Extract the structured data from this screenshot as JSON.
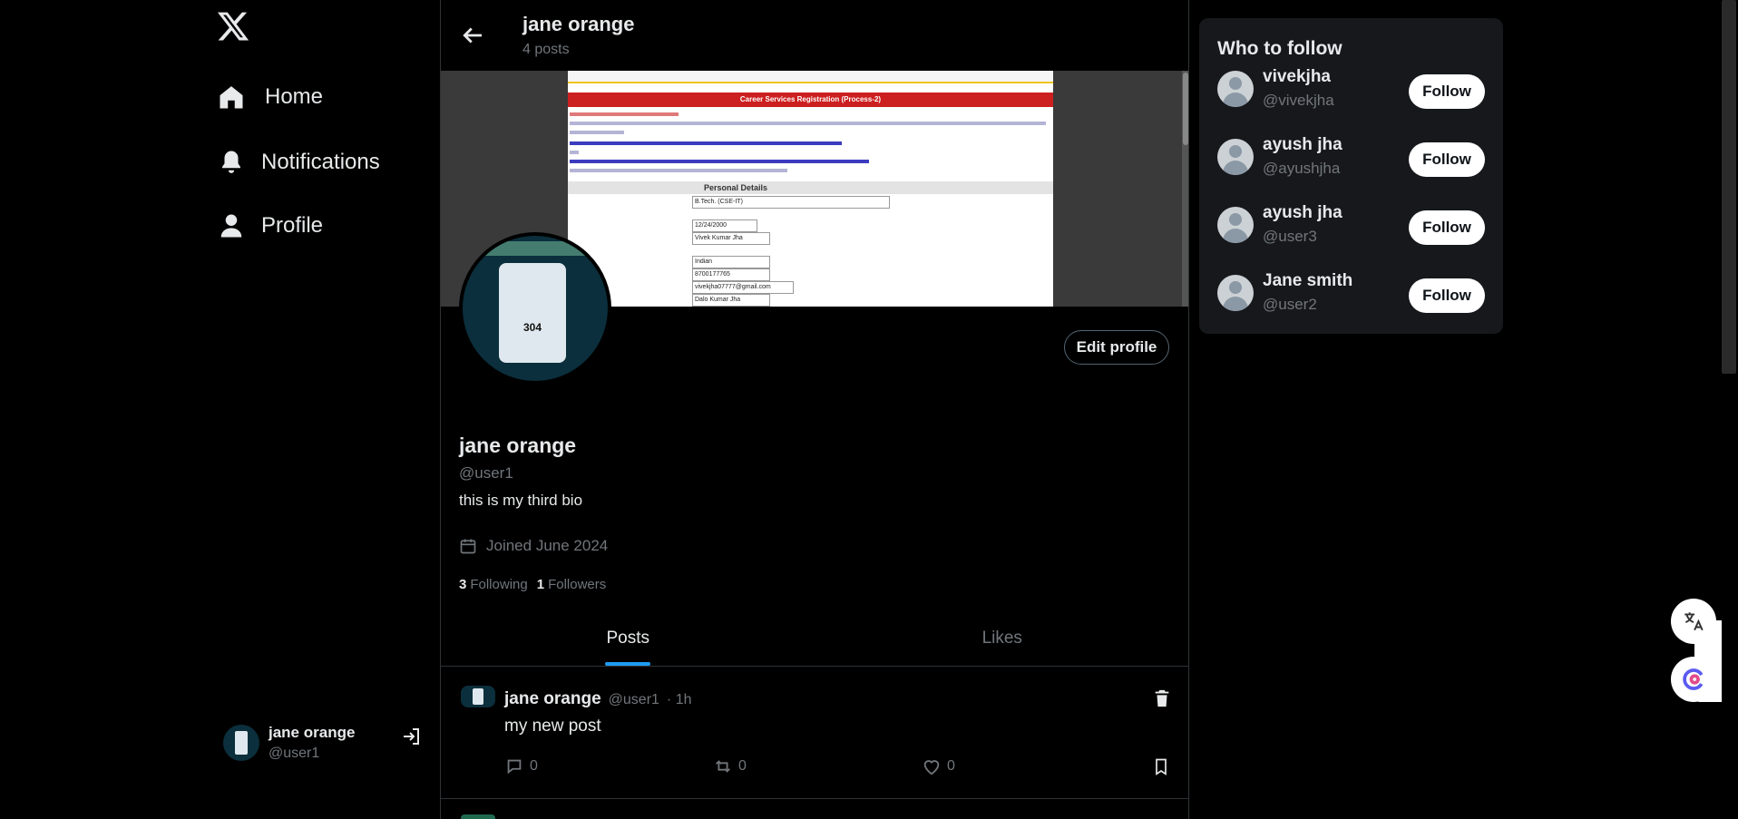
{
  "nav": {
    "items": [
      {
        "label": "Home",
        "icon": "home-icon"
      },
      {
        "label": "Notifications",
        "icon": "bell-icon"
      },
      {
        "label": "Profile",
        "icon": "person-icon"
      }
    ],
    "me": {
      "name": "jane orange",
      "handle": "@user1"
    }
  },
  "header": {
    "title": "jane orange",
    "subtitle": "4 posts"
  },
  "banner": {
    "doc_title": "Career Services Registration (Process-2)",
    "table_header": "Personal Details",
    "fields": [
      "B.Tech. (CSE-IT)",
      "12/24/2000",
      "Vivek Kumar Jha",
      "Indian",
      "8700177765",
      "vivekjha07777@gmail.com",
      "Dalo Kumar Jha"
    ],
    "phone_text": "304"
  },
  "profile": {
    "name": "jane orange",
    "handle": "@user1",
    "bio": "this is my third bio",
    "joined": "Joined June 2024",
    "following_count": "3",
    "following_label": "Following",
    "followers_count": "1",
    "followers_label": "Followers",
    "edit_label": "Edit profile"
  },
  "tabs": [
    "Posts",
    "Likes"
  ],
  "posts": [
    {
      "name": "jane orange",
      "handle": "@user1",
      "time": "· 1h",
      "text": "my new post",
      "replies": "0",
      "reposts": "0",
      "likes": "0"
    }
  ],
  "who_to_follow": {
    "title": "Who to follow",
    "follow_label": "Follow",
    "users": [
      {
        "name": "vivekjha",
        "handle": "@vivekjha"
      },
      {
        "name": "ayush jha",
        "handle": "@ayushjha"
      },
      {
        "name": "ayush jha",
        "handle": "@user3"
      },
      {
        "name": "Jane smith",
        "handle": "@user2"
      }
    ]
  },
  "colors": {
    "accent": "#1d9bf0",
    "background": "#000000",
    "muted": "#71767b",
    "card": "#16181c"
  }
}
